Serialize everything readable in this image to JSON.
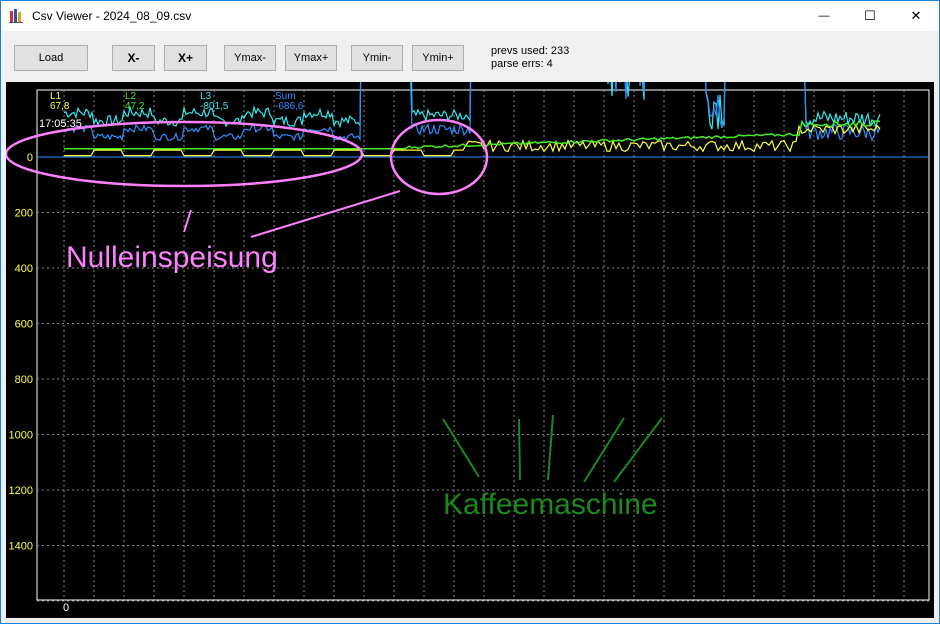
{
  "window": {
    "title": "Csv Viewer - 2024_08_09.csv"
  },
  "titlebar_buttons": {
    "minimize": "—",
    "maximize": "☐",
    "close": "✕"
  },
  "toolbar": {
    "load": "Load",
    "x_minus": "X-",
    "x_plus": "X+",
    "ymax_minus": "Ymax-",
    "ymax_plus": "Ymax+",
    "ymin_minus": "Ymin-",
    "ymin_plus": "Ymin+",
    "prevs_used": "prevs used: 233",
    "parse_errs": "parse errs: 4"
  },
  "legend": [
    {
      "name": "L1",
      "value": "67,8",
      "color": "#ffff40"
    },
    {
      "name": "L2",
      "value": "47,2",
      "color": "#44ee22"
    },
    {
      "name": "L3",
      "value": "-801,5",
      "color": "#30e8f0"
    },
    {
      "name": "Sum",
      "value": "-686,6",
      "color": "#2f8fff"
    }
  ],
  "cursor_time": "17:05:35",
  "x_origin_label": "0",
  "chart_data": {
    "type": "line",
    "y_ticks": [
      "0",
      "200",
      "400",
      "600",
      "800",
      "1000",
      "1200",
      "1400"
    ],
    "ylim": [
      -1550,
      50
    ],
    "grid": true,
    "series": [
      {
        "name": "L1",
        "color": "#ffff40"
      },
      {
        "name": "L2",
        "color": "#44ee22"
      },
      {
        "name": "L3",
        "color": "#30e8f0"
      },
      {
        "name": "Sum",
        "color": "#2f8fff"
      }
    ]
  },
  "annotations": {
    "nulleinspeisung": "Nulleinspeisung",
    "kaffeemaschine": "Kaffeemaschine",
    "pink": "#ff80ff",
    "green": "#1a8a1a"
  }
}
